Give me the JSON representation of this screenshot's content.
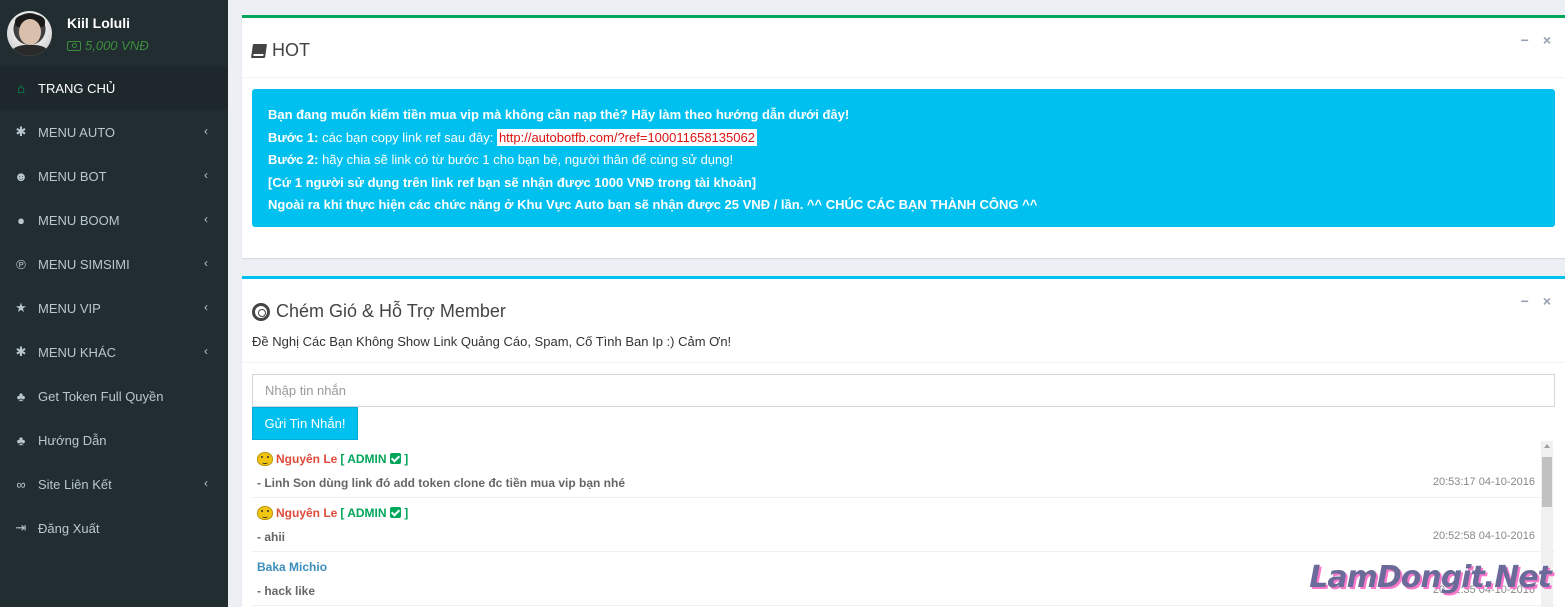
{
  "user": {
    "name": "Kiil Loluli",
    "balance": "5,000 VNĐ"
  },
  "sidebar": {
    "items": [
      {
        "label": "TRANG CHỦ",
        "icon": "home-icon",
        "glyph": "⌂",
        "active": true,
        "has_submenu": false
      },
      {
        "label": "MENU AUTO",
        "icon": "cogs-icon",
        "glyph": "✱",
        "active": false,
        "has_submenu": true
      },
      {
        "label": "MENU BOT",
        "icon": "reddit-icon",
        "glyph": "☻",
        "active": false,
        "has_submenu": true
      },
      {
        "label": "MENU BOOM",
        "icon": "bomb-icon",
        "glyph": "●",
        "active": false,
        "has_submenu": true
      },
      {
        "label": "MENU SIMSIMI",
        "icon": "pinterest-icon",
        "glyph": "℗",
        "active": false,
        "has_submenu": true
      },
      {
        "label": "MENU VIP",
        "icon": "star-icon",
        "glyph": "★",
        "active": false,
        "has_submenu": true
      },
      {
        "label": "MENU KHÁC",
        "icon": "cogs-icon",
        "glyph": "✱",
        "active": false,
        "has_submenu": true
      },
      {
        "label": "Get Token Full Quyền",
        "icon": "leaf-icon",
        "glyph": "♣",
        "active": false,
        "has_submenu": false
      },
      {
        "label": "Hướng Dẫn",
        "icon": "leaf-icon",
        "glyph": "♣",
        "active": false,
        "has_submenu": false
      },
      {
        "label": "Site Liên Kết",
        "icon": "link-icon",
        "glyph": "∞",
        "active": false,
        "has_submenu": true
      },
      {
        "label": "Đăng Xuất",
        "icon": "sign-out-icon",
        "glyph": "⇥",
        "active": false,
        "has_submenu": false
      }
    ]
  },
  "hot_box": {
    "title": "HOT",
    "line1": "Bạn đang muốn kiếm tiền mua vip mà không cần nạp thẻ? Hãy làm theo hướng dẫn dưới đây!",
    "step1_label": "Bước 1:",
    "step1_text": " các bạn copy link ref sau đây: ",
    "ref_link": "http://autobotfb.com/?ref=100011658135062",
    "step2_label": "Bước 2:",
    "step2_text": " hãy chia sẽ link có từ bước 1 cho bạn bè, người thân để cùng sử dụng!",
    "line4": "[Cứ 1 người sử dụng trên link ref bạn sẽ nhận được 1000 VNĐ trong tài khoản]",
    "line5": "Ngoài ra khi thực hiện các chức năng ở Khu Vực Auto bạn sẽ nhận được 25 VNĐ / lần. ^^ CHÚC CÁC BẠN THÀNH CÔNG ^^"
  },
  "chat_box": {
    "title": "Chém Gió & Hỗ Trợ Member",
    "subtitle": "Đề Nghị Các Bạn Không Show Link Quảng Cáo, Spam, Cố Tình Ban Ip :) Cảm Ơn!",
    "input_placeholder": "Nhập tin nhắn",
    "send_label": "Gửi Tin Nhắn!",
    "messages": [
      {
        "author": "Nguyên Le",
        "role": "[ ADMIN ",
        "role_end": " ]",
        "text": "- Linh Son dùng link đó add token clone đc tiền mua vip bạn nhé",
        "time": "20:53:17 04-10-2016"
      },
      {
        "author": "Nguyên Le",
        "role": "[ ADMIN ",
        "role_end": " ]",
        "text": "- ahii",
        "time": "20:52:58 04-10-2016"
      },
      {
        "author": "Baka Michio",
        "text": "- hack like",
        "time": "20:52:35 04-10-2016"
      }
    ]
  },
  "box_tools": {
    "collapse": "−",
    "remove": "×"
  },
  "watermark": "LamDongit.Net",
  "colors": {
    "sidebar_bg": "#222d32",
    "active_icon": "#00a65a",
    "callout_bg": "#00c0ef",
    "admin_name": "#dd4b39",
    "admin_tag": "#00a65a",
    "user_name": "#3c8dbc"
  }
}
